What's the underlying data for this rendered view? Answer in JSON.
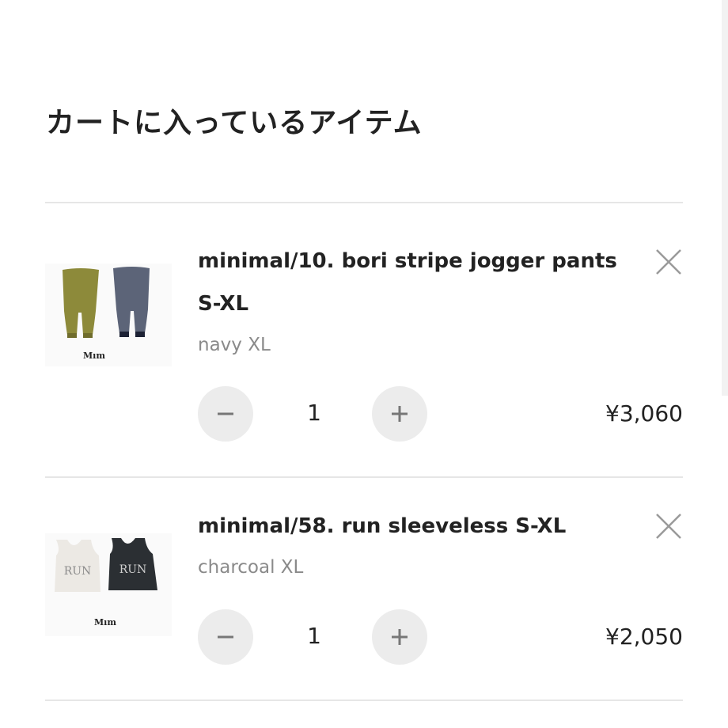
{
  "page": {
    "title": "カートに入っているアイテム"
  },
  "cart": {
    "items": [
      {
        "name": "minimal/10. bori stripe jogger pants S-XL",
        "variant": "navy XL",
        "quantity": "1",
        "price": "¥3,060",
        "thumb_brand": "Mım",
        "thumb_colors": [
          "#8d8a3a",
          "#5c6478"
        ]
      },
      {
        "name": "minimal/58. run sleeveless S-XL",
        "variant": "charcoal XL",
        "quantity": "1",
        "price": "¥2,050",
        "thumb_brand": "Mım",
        "thumb_print": "RUN",
        "thumb_colors": [
          "#ece9e4",
          "#2b2f33"
        ]
      }
    ]
  },
  "icons": {
    "remove": "close-icon",
    "decrement": "minus-icon",
    "increment": "plus-icon"
  }
}
